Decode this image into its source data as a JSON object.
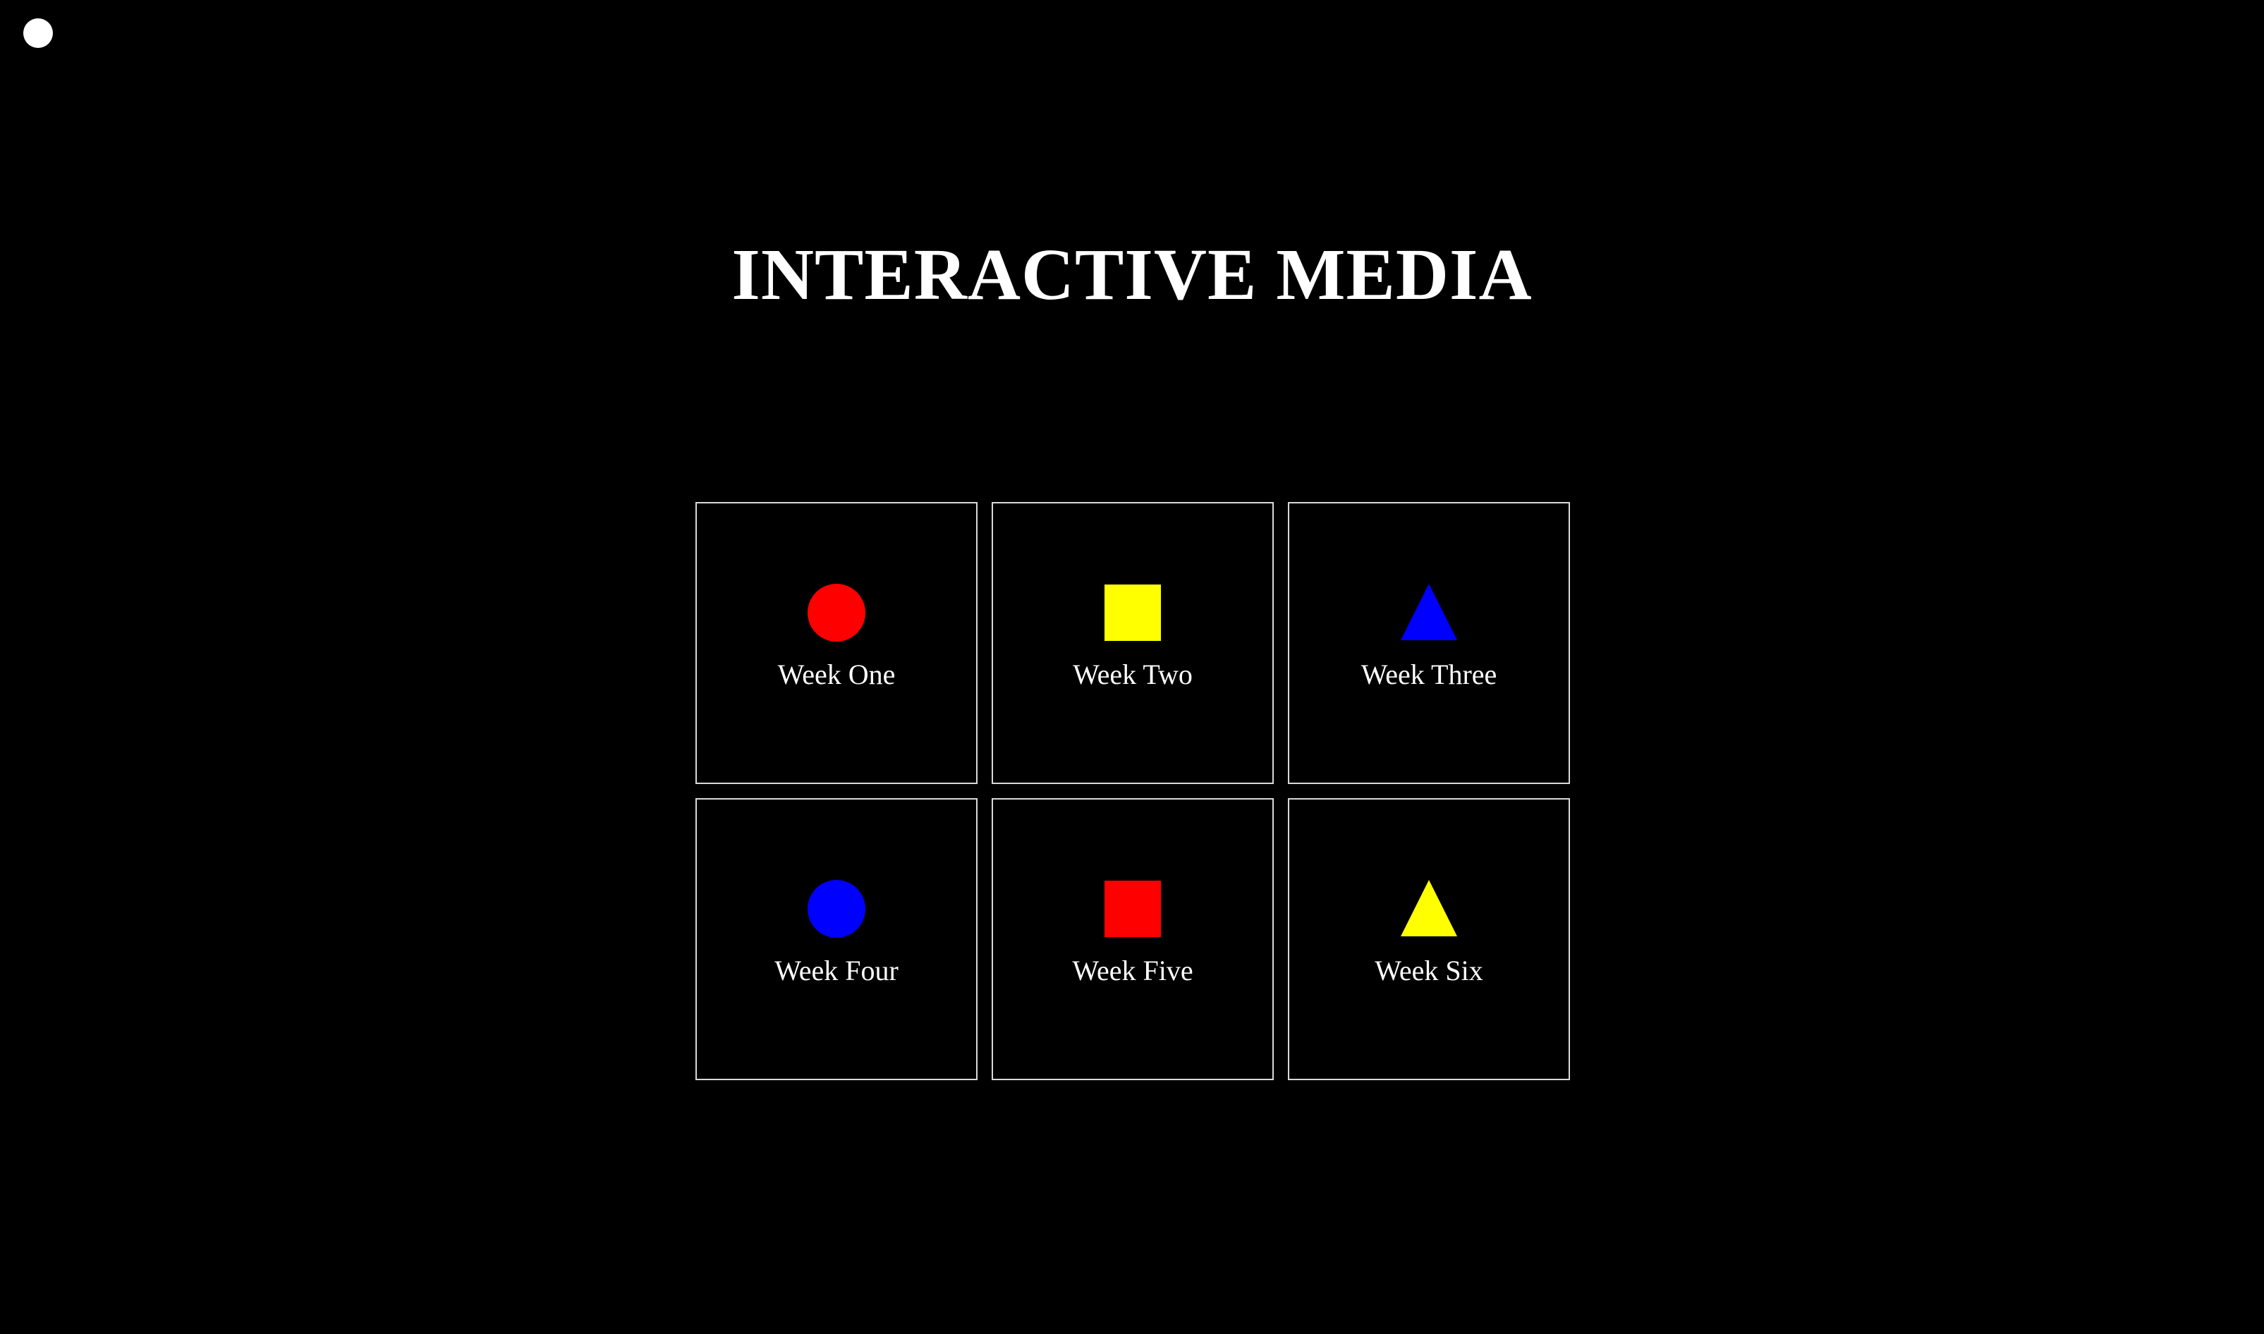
{
  "page": {
    "title": "INTERACTIVE MEDIA",
    "background_color": "#000000",
    "text_color": "#ffffff"
  },
  "cursor": {
    "icon": "cursor-dot-icon",
    "color": "#ffffff"
  },
  "weeks": [
    {
      "label": "Week One",
      "shape": "circle",
      "color": "#ff0000"
    },
    {
      "label": "Week Two",
      "shape": "square",
      "color": "#ffff00"
    },
    {
      "label": "Week Three",
      "shape": "triangle",
      "color": "#0000ff"
    },
    {
      "label": "Week Four",
      "shape": "circle",
      "color": "#0000ff"
    },
    {
      "label": "Week Five",
      "shape": "square",
      "color": "#ff0000"
    },
    {
      "label": "Week Six",
      "shape": "triangle",
      "color": "#ffff00"
    }
  ]
}
